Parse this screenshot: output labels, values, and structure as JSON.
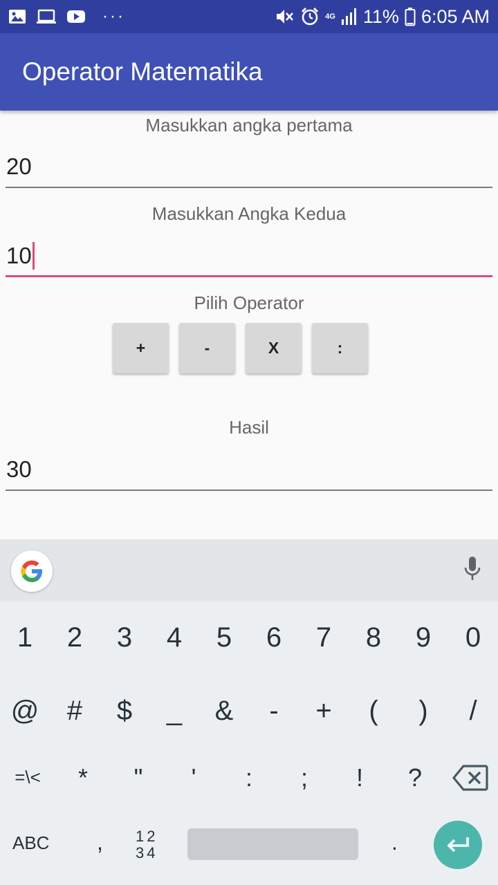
{
  "status_bar": {
    "battery_percent": "11%",
    "time": "6:05 AM",
    "network_label": "4G",
    "icons": [
      "gallery-icon",
      "laptop-icon",
      "youtube-icon",
      "more-icon",
      "mute-icon",
      "alarm-icon",
      "signal-icon",
      "battery-icon"
    ]
  },
  "app_bar": {
    "title": "Operator Matematika"
  },
  "form": {
    "first_label": "Masukkan angka pertama",
    "first_value": "20",
    "second_label": "Masukkan Angka Kedua",
    "second_value": "10",
    "operator_label": "Pilih Operator",
    "operators": [
      "+",
      "-",
      "X",
      ":"
    ],
    "result_label": "Hasil",
    "result_value": "30"
  },
  "keyboard": {
    "row1": [
      "1",
      "2",
      "3",
      "4",
      "5",
      "6",
      "7",
      "8",
      "9",
      "0"
    ],
    "row2": [
      "@",
      "#",
      "$",
      "_",
      "&",
      "-",
      "+",
      "(",
      ")",
      "/"
    ],
    "row3": [
      "=\\<",
      "*",
      "\"",
      "'",
      ":",
      ";",
      "!",
      "?"
    ],
    "abc_label": "ABC",
    "comma_label": ",",
    "numpad_line1": "12",
    "numpad_line2": "34",
    "period_label": "."
  },
  "colors": {
    "status_bar": "#303f9f",
    "app_bar": "#3f51b5",
    "accent": "#e0487a",
    "enter_key": "#4db6ac"
  }
}
